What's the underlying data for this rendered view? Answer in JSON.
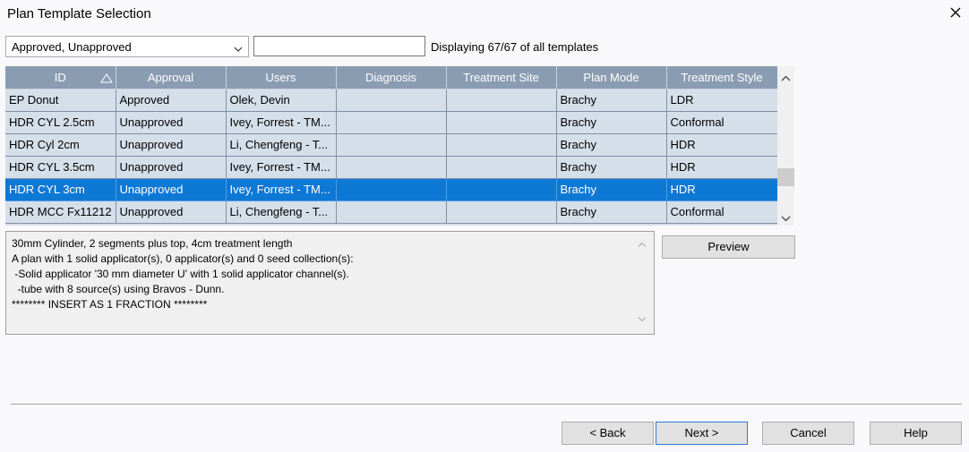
{
  "window": {
    "title": "Plan Template Selection"
  },
  "filter": {
    "selected": "Approved, Unapproved"
  },
  "search": {
    "value": "",
    "placeholder": ""
  },
  "status": {
    "display_count": "Displaying 67/67 of all templates"
  },
  "table": {
    "columns": [
      "ID",
      "Approval",
      "Users",
      "Diagnosis",
      "Treatment Site",
      "Plan Mode",
      "Treatment Style"
    ],
    "sorted_column": "ID",
    "selected_row": 4,
    "rows": [
      [
        "EP Donut",
        "Approved",
        "Olek, Devin",
        "",
        "",
        "Brachy",
        "LDR"
      ],
      [
        "HDR CYL 2.5cm",
        "Unapproved",
        "Ivey, Forrest - TM...",
        "",
        "",
        "Brachy",
        "Conformal"
      ],
      [
        "HDR Cyl 2cm",
        "Unapproved",
        "Li, Chengfeng - T...",
        "",
        "",
        "Brachy",
        "HDR"
      ],
      [
        "HDR CYL 3.5cm",
        "Unapproved",
        "Ivey, Forrest - TM...",
        "",
        "",
        "Brachy",
        "HDR"
      ],
      [
        "HDR CYL 3cm",
        "Unapproved",
        "Ivey, Forrest - TM...",
        "",
        "",
        "Brachy",
        "HDR"
      ],
      [
        "HDR MCC Fx11212",
        "Unapproved",
        "Li, Chengfeng - T...",
        "",
        "",
        "Brachy",
        "Conformal"
      ]
    ]
  },
  "description": {
    "lines": [
      "30mm Cylinder, 2 segments plus top, 4cm treatment length",
      "A plan with 1 solid applicator(s), 0 applicator(s) and 0 seed collection(s):",
      " -Solid applicator '30 mm diameter U' with 1 solid applicator channel(s).",
      "  -tube with 8 source(s) using Bravos - Dunn.",
      "******** INSERT AS 1 FRACTION ********"
    ]
  },
  "buttons": {
    "preview": "Preview",
    "back": "< Back",
    "next": "Next >",
    "cancel": "Cancel",
    "help": "Help"
  }
}
